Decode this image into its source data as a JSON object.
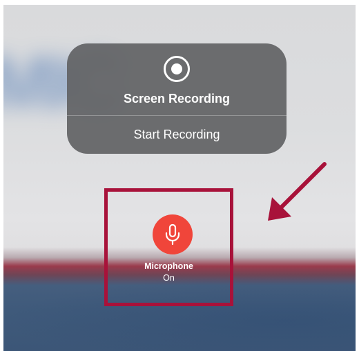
{
  "screen_recording_panel": {
    "title": "Screen Recording",
    "action_label": "Start Recording",
    "icon": "record-icon"
  },
  "microphone": {
    "label": "Microphone",
    "state": "On",
    "icon": "microphone-icon",
    "color": "#f0453a"
  },
  "annotation": {
    "highlight_color": "#a8123a",
    "arrow_icon": "arrow-down-left-icon"
  }
}
